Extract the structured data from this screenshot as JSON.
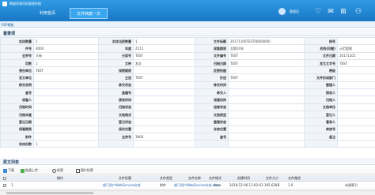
{
  "app": {
    "title": "数据资源归档管理系统",
    "user": "管理员"
  },
  "tabs": [
    {
      "label": "利用首页"
    },
    {
      "label": "文件档案一文"
    }
  ],
  "header_icons": [
    "heart-icon",
    "envelope-icon",
    "cart-icon",
    "user-icon"
  ],
  "breadcrumb": "EEP模板",
  "section_title": "著录项",
  "form_rows": [
    [
      "实体数量",
      "1",
      "实体当前数量",
      "1",
      "文件标题",
      "20171106TEST00000000",
      "档号",
      ""
    ],
    [
      "件号",
      "0004",
      "年度",
      "Z111",
      "保管期限",
      "至期10年",
      "机构(问题)",
      "示范管理"
    ],
    [
      "全宗号",
      "大新",
      "分类号",
      "TEST",
      "文件编号",
      "TEST",
      "文件日期",
      "20171101"
    ],
    [
      "页数",
      "1",
      "文种",
      "发文",
      "归档日期",
      "TEST",
      "发文文字号",
      "TEST"
    ],
    [
      "责任单位",
      "TEST",
      "保密期限",
      "",
      "定密依据",
      "",
      "密级",
      ""
    ],
    [
      "发文单位",
      "",
      "主送",
      "TEST",
      "抄送",
      "TEST",
      "文件形成部门",
      ""
    ],
    [
      "移交说明",
      "",
      "移交状态",
      "",
      "移交时间",
      "",
      "整理人",
      ""
    ],
    [
      "盒号",
      "",
      "盒幅号",
      "",
      "移交人",
      "",
      "接收人",
      ""
    ],
    [
      "保管人",
      "",
      "接收时间",
      "",
      "保管机构",
      "",
      "归档人",
      ""
    ],
    [
      "归档时间",
      "",
      "归档状态",
      "",
      "组卷状态",
      "",
      "立档单位",
      ""
    ],
    [
      "归档年度",
      "",
      "文档格式",
      "",
      "文档类型",
      "",
      "登记人",
      ""
    ],
    [
      "登记日期",
      "",
      "登记状态",
      "",
      "整理状态",
      "",
      "著录人",
      ""
    ],
    [
      "保管期限",
      "",
      "保存位置",
      "",
      "存放位置",
      "",
      "库房号",
      ""
    ],
    [
      "附件",
      "",
      "全宗号",
      "3800",
      "盒号",
      "",
      "备注",
      ""
    ],
    [
      "实体份数",
      "1",
      "",
      "",
      "",
      "",
      "",
      ""
    ]
  ],
  "attachments": {
    "title": "原文列表",
    "toolbar": [
      {
        "label": "下载",
        "icon": "download-icon"
      },
      {
        "label": "批量上传",
        "icon": "upload-icon"
      },
      {
        "label": "检索",
        "icon": "search-icon"
      },
      {
        "label": "图片检索",
        "icon": "image-icon"
      }
    ],
    "columns": [
      "操作",
      "文件标题",
      "文件类型",
      "文件名称",
      "文件格式",
      "创建时间",
      "文件大小",
      "文件路径"
    ],
    "rows": [
      [
        "部门用户WebService文档",
        "附件",
        "部门用户WebService文档.docx",
        "docx",
        "2018-12-06 11:02:03",
        "195.62KB",
        "1.0",
        "未建索引"
      ]
    ]
  }
}
